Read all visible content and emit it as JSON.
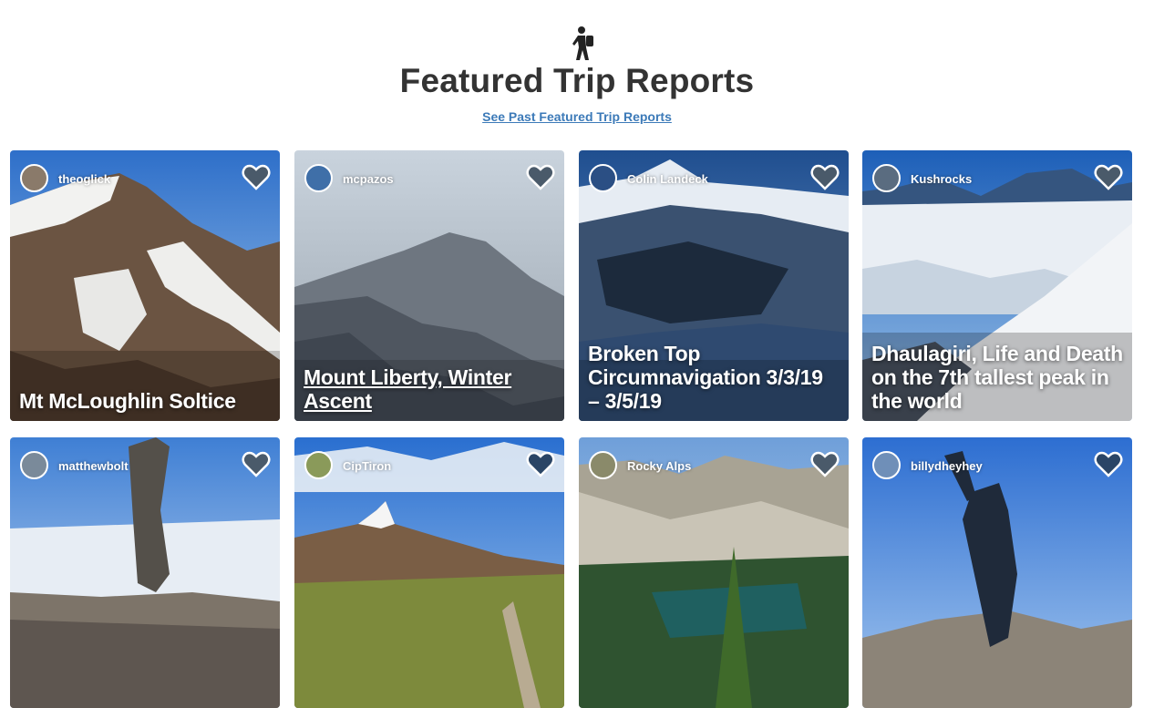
{
  "header": {
    "icon": "hiker-icon",
    "title": "Featured Trip Reports",
    "past_link": "See Past Featured Trip Reports"
  },
  "colors": {
    "link": "#3c7ab8",
    "title": "#333333",
    "heart_fill": "#4a5a6a"
  },
  "cards": [
    {
      "user": "theoglick",
      "title": "Mt McLoughlin Soltice"
    },
    {
      "user": "mcpazos",
      "title": "Mount Liberty, Winter Ascent"
    },
    {
      "user": "Colin Landeck",
      "title": "Broken Top Circumnavigation 3/3/19 – 3/5/19"
    },
    {
      "user": "Kushrocks",
      "title": "Dhaulagiri, Life and Death on the 7th tallest peak in the world"
    },
    {
      "user": "matthewbolt",
      "title": ""
    },
    {
      "user": "CipTiron",
      "title": ""
    },
    {
      "user": "Rocky Alps",
      "title": ""
    },
    {
      "user": "billydheyhey",
      "title": ""
    }
  ]
}
